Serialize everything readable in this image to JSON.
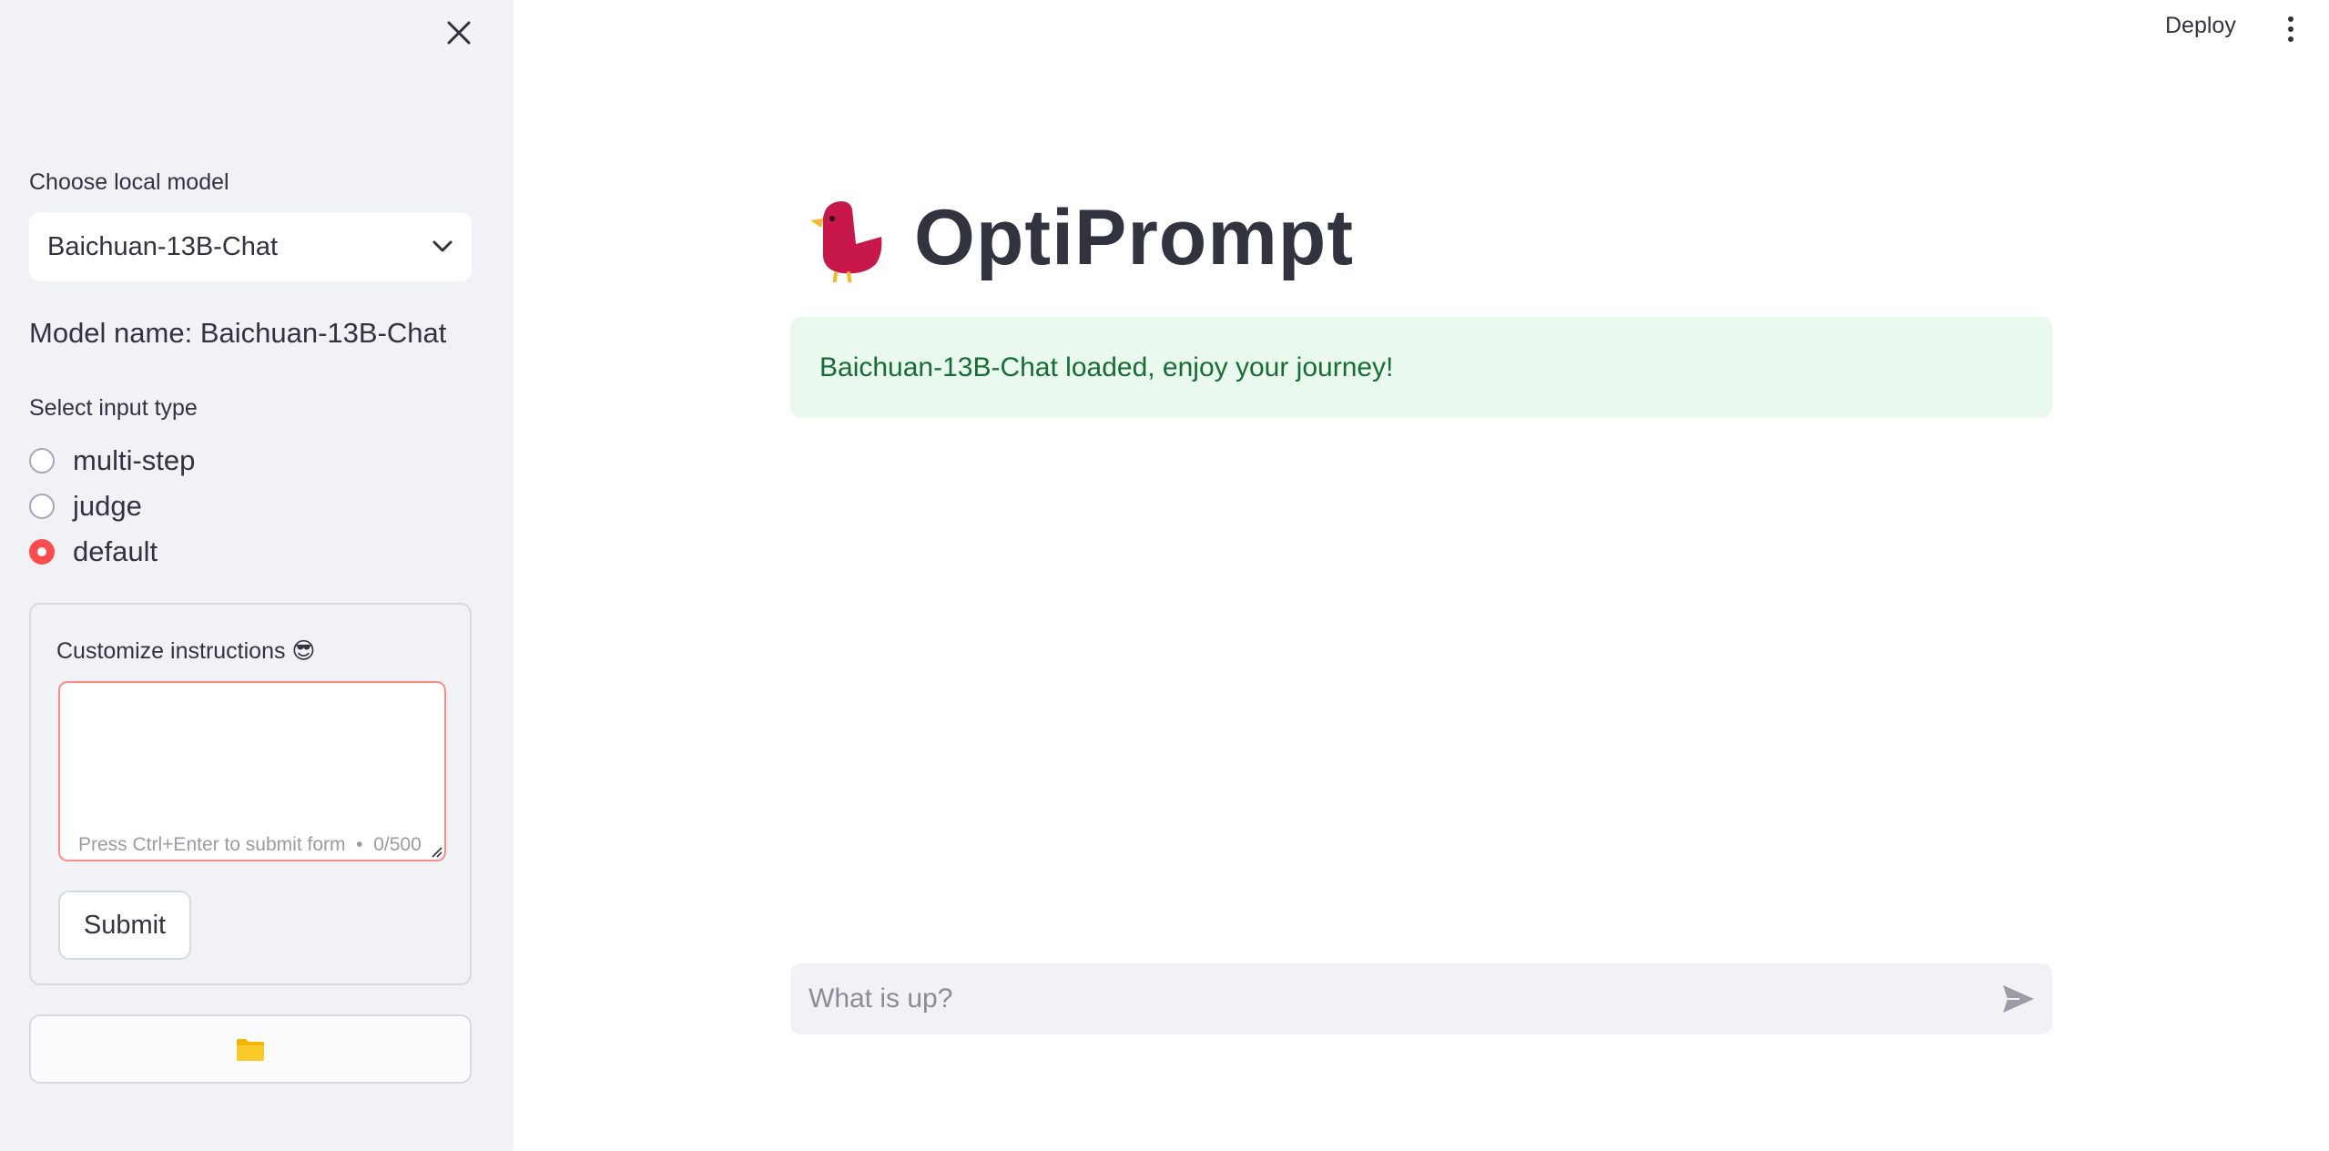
{
  "sidebar": {
    "model_label": "Choose local model",
    "model_selected": "Baichuan-13B-Chat",
    "model_name_text": "Model name: Baichuan-13B-Chat",
    "input_type_label": "Select input type",
    "input_types": [
      {
        "label": "multi-step",
        "selected": false
      },
      {
        "label": "judge",
        "selected": false
      },
      {
        "label": "default",
        "selected": true
      }
    ],
    "form": {
      "label": "Customize instructions 😎",
      "value": "",
      "hint": "Press Ctrl+Enter to submit form",
      "counter": "0/500",
      "submit_label": "Submit"
    },
    "folder_icon": "folder-icon"
  },
  "header": {
    "deploy_label": "Deploy",
    "menu_icon": "kebab-menu-icon"
  },
  "main": {
    "title": "OptiPrompt",
    "logo_icon": "bird-logo-icon",
    "alert_text": "Baichuan-13B-Chat loaded, enjoy your journey!",
    "chat_placeholder": "What is up?",
    "send_icon": "send-icon"
  },
  "colors": {
    "accent": "#ff4b4b",
    "success_bg": "#e9f9ee",
    "success_text": "#176c36",
    "sidebar_bg": "#f0f2f6",
    "logo": "#c8174a"
  }
}
